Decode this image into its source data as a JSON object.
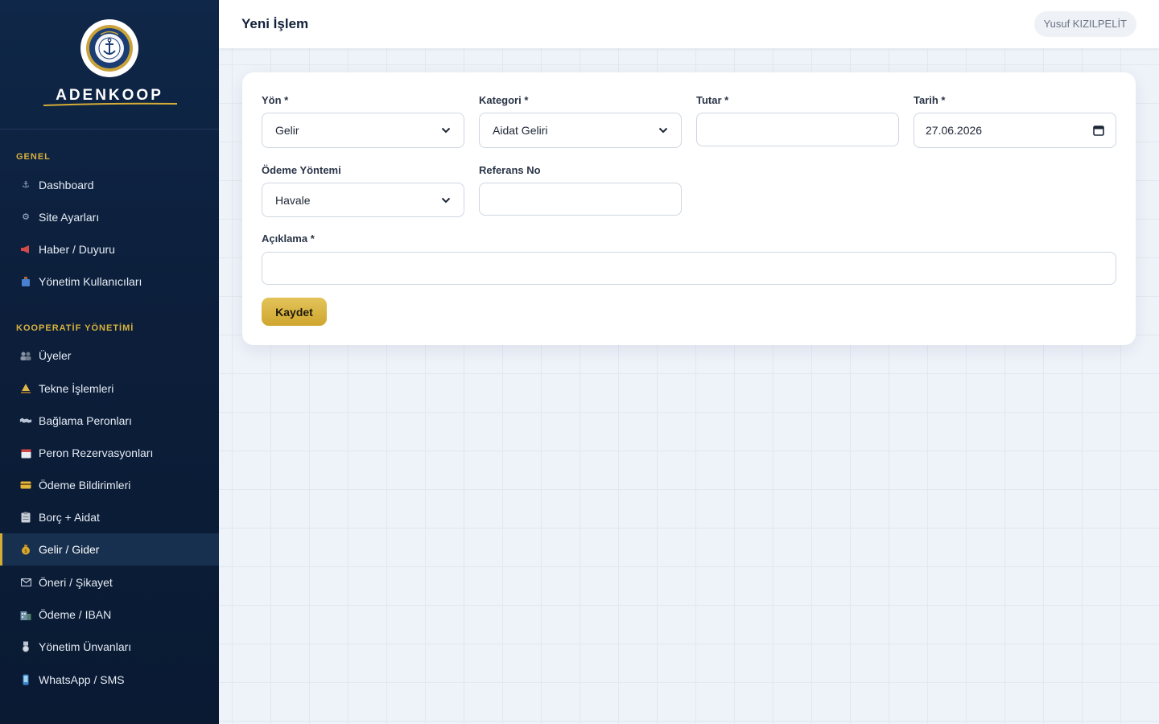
{
  "brand": {
    "name": "ADENKOOP"
  },
  "sidebar": {
    "sections": [
      {
        "title": "GENEL"
      },
      {
        "title": "KOOPERATİF YÖNETİMİ"
      }
    ],
    "items": [
      {
        "label": "Dashboard",
        "icon": "anchor-icon"
      },
      {
        "label": "Site Ayarları",
        "icon": "gear-icon"
      },
      {
        "label": "Haber / Duyuru",
        "icon": "megaphone-icon"
      },
      {
        "label": "Yönetim Kullanıcıları",
        "icon": "users-icon"
      },
      {
        "label": "Üyeler",
        "icon": "members-icon"
      },
      {
        "label": "Tekne İşlemleri",
        "icon": "sailboat-icon"
      },
      {
        "label": "Bağlama Peronları",
        "icon": "map-icon"
      },
      {
        "label": "Peron Rezervasyonları",
        "icon": "calendar-icon"
      },
      {
        "label": "Ödeme Bildirimleri",
        "icon": "credit-card-icon"
      },
      {
        "label": "Borç + Aidat",
        "icon": "clipboard-icon"
      },
      {
        "label": "Gelir / Gider",
        "icon": "money-bag-icon"
      },
      {
        "label": "Öneri / Şikayet",
        "icon": "envelope-icon"
      },
      {
        "label": "Ödeme / IBAN",
        "icon": "bank-icon"
      },
      {
        "label": "Yönetim Ünvanları",
        "icon": "medal-icon"
      },
      {
        "label": "WhatsApp / SMS",
        "icon": "phone-icon"
      }
    ],
    "active_item": "Gelir / Gider",
    "accent_color": "#d4ad35"
  },
  "header": {
    "title": "Yeni İşlem",
    "user_name": "Yusuf KIZILPELİT"
  },
  "form": {
    "yon": {
      "label": "Yön *",
      "value": "Gelir"
    },
    "kategori": {
      "label": "Kategori *",
      "value": "Aidat Geliri"
    },
    "tutar": {
      "label": "Tutar *",
      "value": ""
    },
    "tarih": {
      "label": "Tarih *",
      "value": "27.06.2026"
    },
    "odeme_yontemi": {
      "label": "Ödeme Yöntemi",
      "value": "Havale"
    },
    "referans_no": {
      "label": "Referans No",
      "value": ""
    },
    "aciklama": {
      "label": "Açıklama *",
      "value": ""
    },
    "save_label": "Kaydet"
  }
}
